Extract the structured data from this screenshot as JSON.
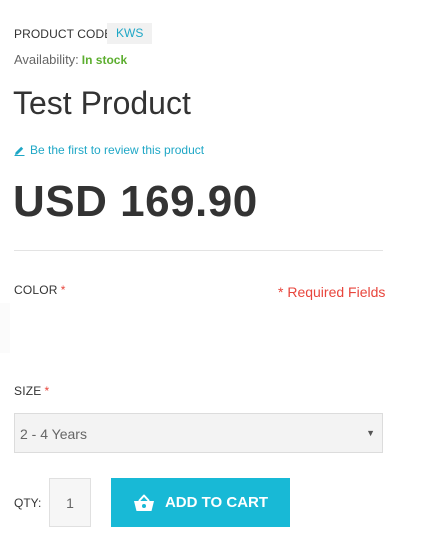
{
  "product": {
    "code_label": "PRODUCT CODE:",
    "code_value": "KWS",
    "availability_label": "Availability:",
    "availability_status": "In stock",
    "title": "Test Product",
    "review_link": "Be the first to review this product",
    "price": "USD 169.90"
  },
  "options": {
    "color_label": "COLOR",
    "required_star": "*",
    "required_note": "* Required Fields",
    "size_label": "SIZE",
    "size_selected": "2 - 4 Years"
  },
  "cart": {
    "qty_label": "QTY:",
    "qty_value": "1",
    "add_to_cart_label": "ADD TO CART"
  },
  "colors": {
    "accent": "#18b9d6",
    "link": "#1fa7c6",
    "in_stock": "#5cae2f",
    "required": "#e8453c"
  },
  "icons": {
    "review": "pencil-icon",
    "cart": "basket-icon",
    "select": "caret-down-icon"
  }
}
